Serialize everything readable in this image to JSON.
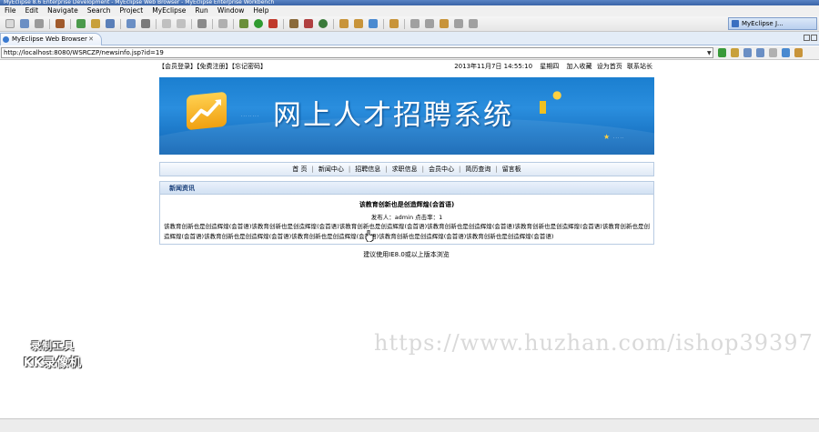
{
  "window": {
    "title": "MyEclipse 8.6 Enterprise Development - MyEclipse Web Browser - MyEclipse Enterprise Workbench"
  },
  "menu": [
    "File",
    "Edit",
    "Navigate",
    "Search",
    "Project",
    "MyEclipse",
    "Run",
    "Window",
    "Help"
  ],
  "perspective": {
    "label": "MyEclipse J..."
  },
  "tab": {
    "label": "MyEclipse Web Browser",
    "close": "✕"
  },
  "address": {
    "url": "http://localhost:8080/WSRCZP/newsinfo.jsp?id=19"
  },
  "page": {
    "top_links": "【会员登录】【免费注册】【忘记密码】",
    "date": "2013年11月7日 14:55:10",
    "weekday": "星期四",
    "add_favorite": "加入收藏",
    "set_home": "设为首页",
    "contact": "联系站长",
    "banner_title": "网上人才招聘系统",
    "nav": [
      "首 页",
      "新闻中心",
      "招聘信息",
      "求职信息",
      "会员中心",
      "简历查询",
      "留言板"
    ],
    "section_label": "新闻资讯",
    "news_title": "该教育创新也是创造辉煌(会首语)",
    "news_meta": "发布人：admin 点击率：1",
    "news_body": "该教育创新也是创造辉煌(会首语)该教育创新也是创造辉煌(会首语)该教育创新也是创造辉煌(会首语)该教育创新也是创造辉煌(会首语)该教育创新也是创造辉煌(会首语)该教育创新也是创造辉煌(会首语)该教育创新也是创造辉煌(会首语)该教育创新也是创造辉煌(会首语)该教育创新也是创造辉煌(会首语)该教育创新也是创造辉煌(会首语)",
    "footer": "建议使用IE8.0或以上版本浏览"
  },
  "overlay": {
    "watermark": "https://www.huzhan.com/ishop39397",
    "recorder_line1": "录制工具",
    "recorder_line2": "KK录像机"
  },
  "colors": {
    "banner_blue": "#1b7fd0",
    "title_bar": "#3a64a8"
  }
}
